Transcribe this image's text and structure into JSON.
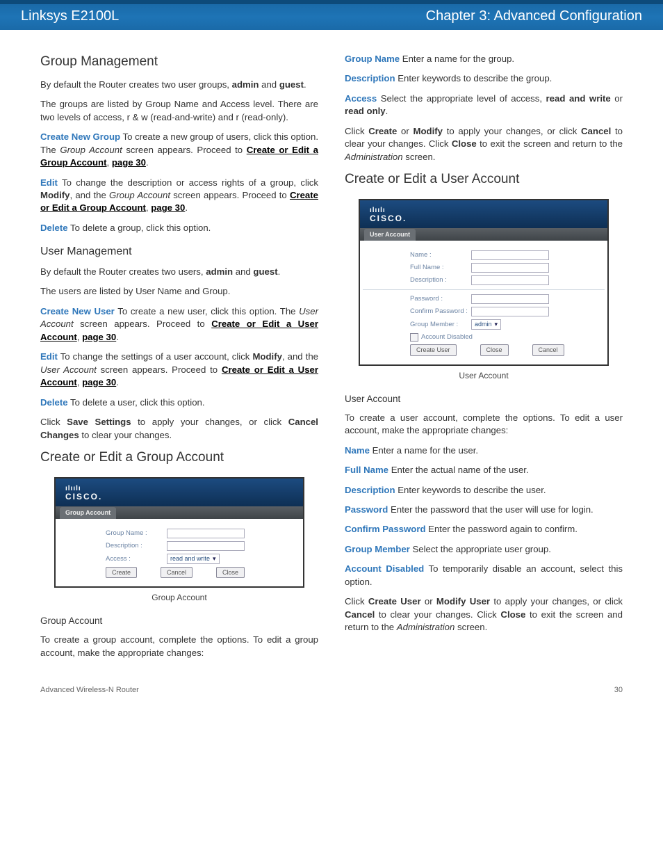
{
  "header": {
    "product": "Linksys E2100L",
    "chapter": "Chapter 3: Advanced Configuration"
  },
  "footer": {
    "left": "Advanced Wireless-N Router",
    "page": "30"
  },
  "col1": {
    "h_group_mgmt": "Group Management",
    "p1a": "By default the Router creates two user groups, ",
    "p1b": "admin",
    "p1c": " and ",
    "p1d": "guest",
    "p1e": ".",
    "p2": "The groups are listed by Group Name and Access level. There are two levels of access, r & w (read-and-write) and r (read-only).",
    "cng_key": "Create New Group",
    "cng_txt": "  To create a new group of users, click this option. The ",
    "cng_ital": "Group Account",
    "cng_txt2": " screen appears. Proceed to ",
    "cng_link": "Create or Edit a Group Account",
    "cng_sep": ", ",
    "cng_page": "page 30",
    "cng_end": ".",
    "edit_key": "Edit",
    "edit_txt": "  To change the description or access rights of a group, click ",
    "edit_b": "Modify",
    "edit_txt2": ", and the ",
    "edit_ital": "Group Account",
    "edit_txt3": " screen appears. Proceed to ",
    "edit_link": "Create or Edit a Group Account",
    "edit_sep": ", ",
    "edit_page": "page 30",
    "edit_end": ".",
    "del_key": "Delete",
    "del_txt": "  To delete a group, click this option.",
    "h_user_mgmt": "User Management",
    "um_p1a": "By default the Router creates two users, ",
    "um_p1b": "admin",
    "um_p1c": " and ",
    "um_p1d": "guest",
    "um_p1e": ".",
    "um_p2": "The users are listed by User Name and Group.",
    "cnu_key": "Create New User",
    "cnu_txt": " To create a new user, click this option. The ",
    "cnu_ital": "User Account",
    "cnu_txt2": " screen appears. Proceed to ",
    "cnu_link": "Create or Edit a User Account",
    "cnu_sep": ", ",
    "cnu_page": "page 30",
    "cnu_end": ".",
    "uedit_key": "Edit",
    "uedit_txt": " To change the settings of a user account, click ",
    "uedit_b": "Modify",
    "uedit_txt2": ", and the ",
    "uedit_ital": "User Account",
    "uedit_txt3": " screen appears. Proceed to ",
    "uedit_link": "Create or Edit a User Account",
    "uedit_sep": ", ",
    "uedit_page": "page 30",
    "uedit_end": ".",
    "udel_key": "Delete",
    "udel_txt": "  To delete a user, click this option.",
    "save_a": "Click ",
    "save_b": "Save Settings",
    "save_c": " to apply your changes, or click ",
    "save_d": "Cancel Changes",
    "save_e": " to clear your changes.",
    "h_cega": "Create or Edit a Group Account",
    "fig1": {
      "tab": "Group Account",
      "group_name": "Group Name :",
      "description": "Description :",
      "access": "Access :",
      "access_value": "read and write",
      "btn_create": "Create",
      "btn_cancel": "Cancel",
      "btn_close": "Close",
      "caption": "Group Account"
    },
    "h4_ga": "Group Account",
    "ga_p1": "To create a group account, complete the options. To edit a group account, make the appropriate changes:",
    "ga_gn_key": "Group Name",
    "ga_gn_txt": "  Enter a name for the group.",
    "ga_desc_key": "Description",
    "ga_desc_txt": "  Enter keywords to describe the group.",
    "ga_acc_key": "Access",
    "ga_acc_txt": "  Select the appropriate level of access, ",
    "ga_acc_b1": "read and write",
    "ga_acc_mid": " or ",
    "ga_acc_b2": "read only",
    "ga_acc_end": "."
  },
  "col2": {
    "top_a": "Click ",
    "top_b": "Create",
    "top_c": " or ",
    "top_d": "Modify",
    "top_e": " to apply your changes, or click ",
    "top_f": "Cancel",
    "top_g": " to clear your changes. Click ",
    "top_h": "Close",
    "top_i": " to exit the screen and return to the ",
    "top_j": "Administration",
    "top_k": " screen.",
    "h_ceua": "Create or Edit a User Account",
    "fig2": {
      "tab": "User Account",
      "name": "Name :",
      "full_name": "Full Name :",
      "description": "Description :",
      "password": "Password :",
      "confirm_password": "Confirm Password :",
      "group_member": "Group Member :",
      "group_value": "admin",
      "account_disabled": "Account Disabled",
      "btn_create": "Create User",
      "btn_close": "Close",
      "btn_cancel": "Cancel",
      "caption": "User Account"
    },
    "h4_ua": "User Account",
    "ua_p1": "To create a user account, complete the options. To edit a user account, make the appropriate changes:",
    "ua_name_key": "Name",
    "ua_name_txt": "  Enter a name for the user.",
    "ua_fn_key": "Full Name",
    "ua_fn_txt": "  Enter the actual name of the user.",
    "ua_desc_key": "Description",
    "ua_desc_txt": "  Enter keywords to describe the user.",
    "ua_pw_key": "Password",
    "ua_pw_txt": "  Enter the password that the user will use for login.",
    "ua_cpw_key": "Confirm Password",
    "ua_cpw_txt": "  Enter the password again to confirm.",
    "ua_gm_key": "Group Member",
    "ua_gm_txt": "  Select the appropriate user group.",
    "ua_ad_key": "Account Disabled",
    "ua_ad_txt": "  To temporarily disable an account, select this option.",
    "ua_fin_a": "Click ",
    "ua_fin_b": "Create User",
    "ua_fin_c": " or ",
    "ua_fin_d": "Modify User",
    "ua_fin_e": " to apply your changes, or click ",
    "ua_fin_f": "Cancel",
    "ua_fin_g": " to clear your changes. Click ",
    "ua_fin_h": "Close",
    "ua_fin_i": " to exit the screen and return to the ",
    "ua_fin_j": "Administration",
    "ua_fin_k": " screen."
  },
  "cisco": {
    "bars": "ılıılı",
    "text": "CISCO."
  }
}
